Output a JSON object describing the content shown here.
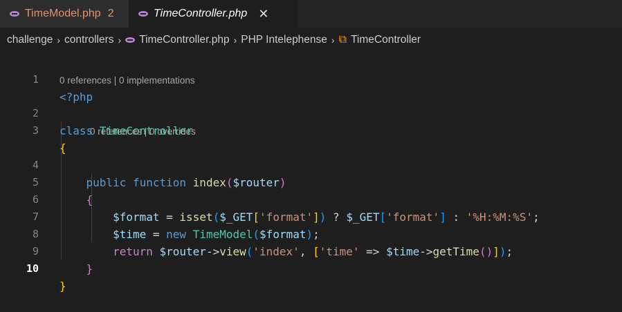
{
  "tabs": [
    {
      "label": "TimeModel.php",
      "problems": "2",
      "icon": "php-elephant-icon"
    },
    {
      "label": "TimeController.php",
      "close": "✕",
      "icon": "php-elephant-icon"
    }
  ],
  "breadcrumb": {
    "items": [
      "challenge",
      "controllers",
      "TimeController.php",
      "PHP Intelephense",
      "TimeController"
    ],
    "separator": "›"
  },
  "editor": {
    "codelens": {
      "class": "0 references | 0 implementations",
      "method": "0 references | 0 overrides"
    },
    "line_numbers": [
      "1",
      "2",
      "3",
      "4",
      "5",
      "6",
      "7",
      "8",
      "9",
      "10"
    ],
    "current_line": "10"
  },
  "colors": {
    "background": "#1e1e1e",
    "tab_inactive_text": "#e2926b",
    "keyword": "#569cd6",
    "class_name": "#4ec9b0",
    "function": "#dcdcaa",
    "variable": "#9cdcfe",
    "string": "#ce9178"
  }
}
